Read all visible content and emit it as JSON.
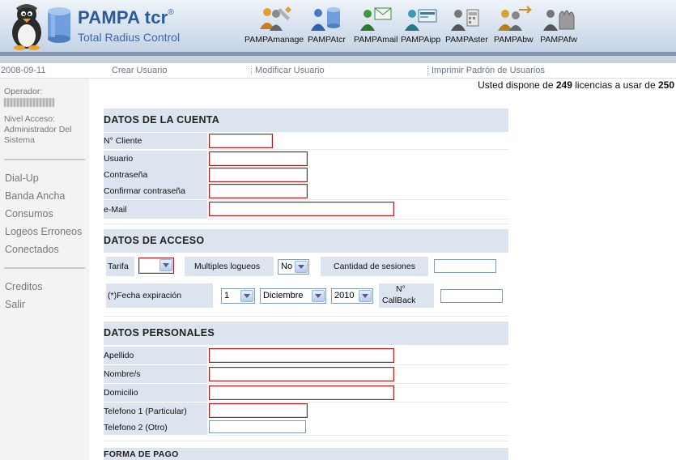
{
  "header": {
    "brand_title": "PAMPA tcr",
    "brand_mark": "®",
    "brand_subtitle": "Total Radius Control",
    "apps": [
      {
        "label": "PAMPAmanage",
        "icon": "users-tools-icon"
      },
      {
        "label": "PAMPAtcr",
        "icon": "users-database-icon"
      },
      {
        "label": "PAMPAmail",
        "icon": "user-mail-icon"
      },
      {
        "label": "PAMPAipp",
        "icon": "user-card-icon"
      },
      {
        "label": "PAMPAster",
        "icon": "user-phone-icon"
      },
      {
        "label": "PAMPAbw",
        "icon": "user-bandwidth-icon"
      },
      {
        "label": "PAMPAfw",
        "icon": "user-firewall-icon"
      }
    ]
  },
  "nav": {
    "date": "2008-09-11",
    "create_user": "Crear Usuario",
    "modify_user": "Modificar Usuario",
    "print_roster": "Imprimir Padrón de Usuarios"
  },
  "license": {
    "prefix": "Usted dispone de",
    "available": "249",
    "middle": "licencias a usar de",
    "total": "250"
  },
  "sidebar": {
    "operator_label": "Operador:",
    "access_level_label": "Nivel Acceso:",
    "access_level_value": "Administrador Del Sistema",
    "menu": [
      "Dial-Up",
      "Banda Ancha",
      "Consumos",
      "Logeos Erroneos",
      "Conectados"
    ],
    "menu2": [
      "Creditos",
      "Salir"
    ]
  },
  "account": {
    "title": "DATOS DE LA CUENTA",
    "fields": [
      {
        "label": "N° Cliente",
        "value": ""
      },
      {
        "label": "Usuario",
        "value": ""
      },
      {
        "label": "Contraseña",
        "value": ""
      },
      {
        "label": "Confirmar contraseña",
        "value": ""
      },
      {
        "label": "e-Mail",
        "value": ""
      }
    ]
  },
  "access": {
    "title": "DATOS DE ACCESO",
    "tarifa_label": "Tarifa",
    "tarifa_value": "",
    "multi_login_label": "Multiples logueos",
    "multi_login_value": "No",
    "sessions_label": "Cantidad de sesiones",
    "sessions_value": "",
    "expiration_label": "(*)Fecha expiración",
    "exp_day": "1",
    "exp_month": "Diciembre",
    "exp_year": "2010",
    "callback_label_1": "N°",
    "callback_label_2": "CallBack",
    "callback_value": ""
  },
  "personal": {
    "title": "DATOS PERSONALES",
    "fields": [
      {
        "label": "Apellido",
        "value": ""
      },
      {
        "label": "Nombre/s",
        "value": ""
      },
      {
        "label": "Domicilio",
        "value": ""
      },
      {
        "label": "Telefono 1 (Particular)",
        "value": ""
      },
      {
        "label": "Telefono 2 (Otro)",
        "value": ""
      }
    ]
  },
  "payment": {
    "title": "FORMA DE PAGO"
  }
}
